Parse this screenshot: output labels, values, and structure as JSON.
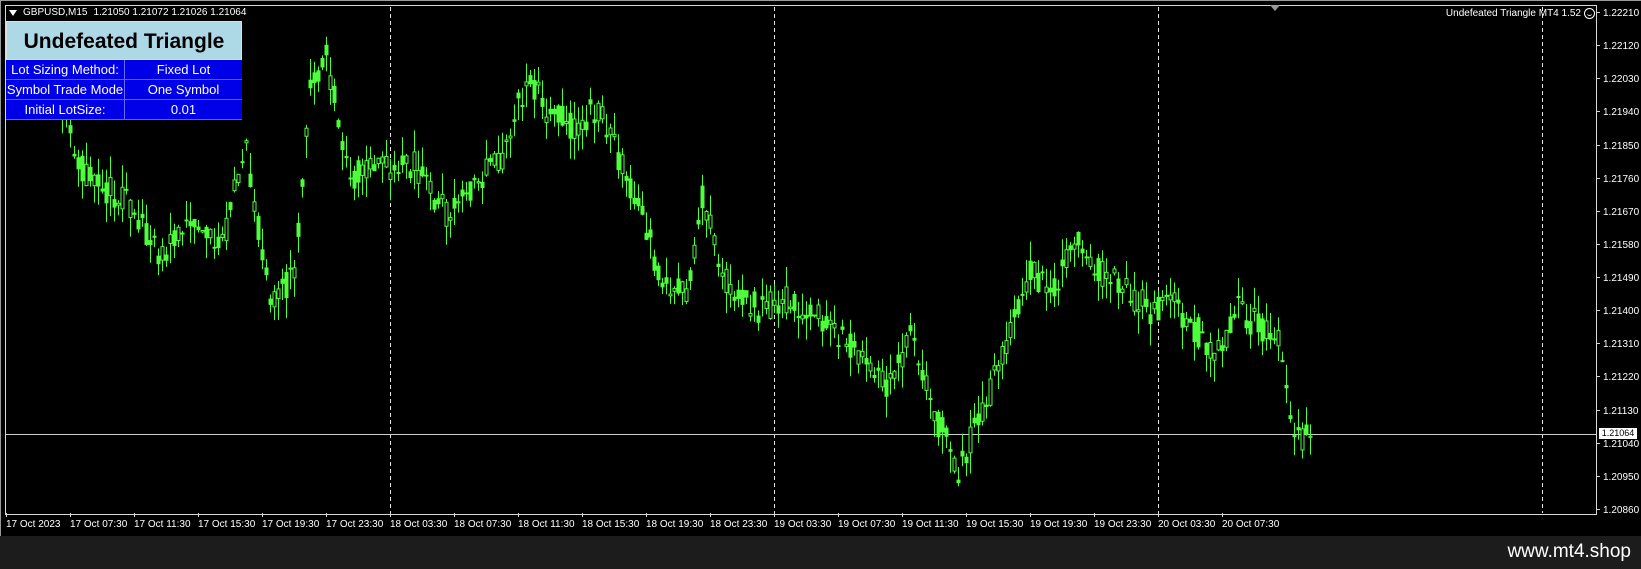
{
  "header": {
    "symbol_timeframe": "GBPUSD,M15",
    "ohlc": "1.21050 1.21072 1.21026 1.21064"
  },
  "ea": {
    "label": "Undefeated Triangle MT4 1.52"
  },
  "panel": {
    "title": "Undefeated Triangle",
    "rows": [
      {
        "label": "Lot Sizing Method:",
        "value": "Fixed Lot"
      },
      {
        "label": "Symbol Trade Mode",
        "value": "One Symbol"
      },
      {
        "label": "Initial LotSize:",
        "value": "0.01"
      }
    ],
    "colors": {
      "title_bg": "#add8e6",
      "row_bg": "#0000e8"
    }
  },
  "current_price": "1.21064",
  "watermark": "www.mt4.shop",
  "colors": {
    "candle": "#4cff3a",
    "background": "#000000",
    "grid": "#e6e6e6"
  },
  "chart_data": {
    "type": "candlestick",
    "symbol": "GBPUSD",
    "timeframe": "M15",
    "ylim": [
      1.2086,
      1.2221
    ],
    "yticks": [
      "1.22210",
      "1.22120",
      "1.22030",
      "1.21940",
      "1.21850",
      "1.21760",
      "1.21670",
      "1.21580",
      "1.21490",
      "1.21400",
      "1.21310",
      "1.21220",
      "1.21130",
      "1.21040",
      "1.20950",
      "1.20860"
    ],
    "xticks": [
      "17 Oct 2023",
      "17 Oct 07:30",
      "17 Oct 11:30",
      "17 Oct 15:30",
      "17 Oct 19:30",
      "17 Oct 23:30",
      "18 Oct 03:30",
      "18 Oct 07:30",
      "18 Oct 11:30",
      "18 Oct 15:30",
      "18 Oct 19:30",
      "18 Oct 23:30",
      "19 Oct 03:30",
      "19 Oct 07:30",
      "19 Oct 11:30",
      "19 Oct 15:30",
      "19 Oct 19:30",
      "19 Oct 23:30",
      "20 Oct 03:30",
      "20 Oct 07:30"
    ],
    "day_separators": [
      "18 Oct 00:00",
      "19 Oct 00:00",
      "20 Oct 00:00",
      "21 Oct 00:00"
    ],
    "current_price": 1.21064,
    "grid": false,
    "price_path": [
      [
        "17 Oct 03:30",
        1.2193
      ],
      [
        "17 Oct 05:00",
        1.2176
      ],
      [
        "17 Oct 07:30",
        1.217
      ],
      [
        "17 Oct 09:30",
        1.2156
      ],
      [
        "17 Oct 11:30",
        1.2162
      ],
      [
        "17 Oct 13:30",
        1.2158
      ],
      [
        "17 Oct 15:00",
        1.2185
      ],
      [
        "17 Oct 16:30",
        1.214
      ],
      [
        "17 Oct 18:00",
        1.215
      ],
      [
        "17 Oct 19:00",
        1.22
      ],
      [
        "17 Oct 20:00",
        1.2208
      ],
      [
        "17 Oct 21:30",
        1.2176
      ],
      [
        "17 Oct 23:30",
        1.2179
      ],
      [
        "18 Oct 01:30",
        1.218
      ],
      [
        "18 Oct 03:30",
        1.2166
      ],
      [
        "18 Oct 05:30",
        1.2175
      ],
      [
        "18 Oct 07:00",
        1.2182
      ],
      [
        "18 Oct 08:30",
        1.2203
      ],
      [
        "18 Oct 10:00",
        1.2193
      ],
      [
        "18 Oct 11:30",
        1.219
      ],
      [
        "18 Oct 13:00",
        1.2195
      ],
      [
        "18 Oct 15:30",
        1.2168
      ],
      [
        "18 Oct 17:00",
        1.2148
      ],
      [
        "18 Oct 18:30",
        1.2143
      ],
      [
        "18 Oct 19:30",
        1.217
      ],
      [
        "18 Oct 21:00",
        1.2148
      ],
      [
        "18 Oct 23:00",
        1.214
      ],
      [
        "19 Oct 01:00",
        1.2143
      ],
      [
        "19 Oct 03:30",
        1.2136
      ],
      [
        "19 Oct 05:30",
        1.2127
      ],
      [
        "19 Oct 07:00",
        1.212
      ],
      [
        "19 Oct 08:30",
        1.2132
      ],
      [
        "19 Oct 10:00",
        1.2112
      ],
      [
        "19 Oct 11:30",
        1.2097
      ],
      [
        "19 Oct 13:00",
        1.2112
      ],
      [
        "19 Oct 14:30",
        1.213
      ],
      [
        "19 Oct 16:00",
        1.215
      ],
      [
        "19 Oct 17:30",
        1.2146
      ],
      [
        "19 Oct 19:00",
        1.216
      ],
      [
        "19 Oct 20:30",
        1.215
      ],
      [
        "19 Oct 22:00",
        1.2145
      ],
      [
        "19 Oct 23:30",
        1.214
      ],
      [
        "20 Oct 01:00",
        1.2142
      ],
      [
        "20 Oct 02:30",
        1.2134
      ],
      [
        "20 Oct 03:30",
        1.2127
      ],
      [
        "20 Oct 05:00",
        1.214
      ],
      [
        "20 Oct 06:30",
        1.2135
      ],
      [
        "20 Oct 07:30",
        1.2131
      ],
      [
        "20 Oct 08:30",
        1.2104
      ],
      [
        "20 Oct 09:30",
        1.21064
      ]
    ]
  }
}
